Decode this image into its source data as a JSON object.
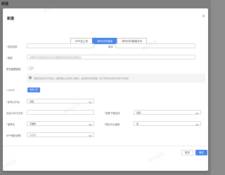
{
  "background": {
    "title": "新建"
  },
  "dialog": {
    "title": "新建",
    "close_icon": "close-icon",
    "tabs": [
      {
        "label": "APK包上传",
        "active": false
      },
      {
        "label": "填写对外链接",
        "active": true
      },
      {
        "label": "填写对内链接文本",
        "active": false
      }
    ]
  },
  "form": {
    "app_name": {
      "label": "应用名称",
      "required": true,
      "value": ""
    },
    "version": {
      "label": "版本",
      "required": false,
      "value": ""
    },
    "link": {
      "label": "链接",
      "required": true,
      "placeholder": "请填写对外链接地址(应该包含跳转到该链接的完整地址)"
    },
    "hide_link": {
      "label": "是否隐藏链接",
      "on": false
    },
    "notice": "隐藏链接后将不显示链接，设置隐藏后无法获取下载地址，如需使用请关闭隐藏，若打开则该应用仅在内部分享中使用",
    "logo": {
      "label": "LOGO",
      "required": true,
      "button": "选择上传"
    },
    "platform": {
      "label": "私有云平台",
      "required": true,
      "value": "请选"
    },
    "apk_file": {
      "label": "自定义APK文件",
      "placeholder": ""
    },
    "device": {
      "label": "多屏下载支持",
      "required": true,
      "value": "请选"
    },
    "rec_pos": {
      "label": "推荐位",
      "required": true,
      "value": "不推荐"
    },
    "show_ok": {
      "label": "是否可以使用",
      "required": true,
      "value": "否"
    },
    "desc": {
      "label": "APP使用说明",
      "placeholder": "请选择"
    }
  },
  "footer": {
    "cancel": "取消",
    "confirm": "确定"
  },
  "watermark": "技术支持"
}
